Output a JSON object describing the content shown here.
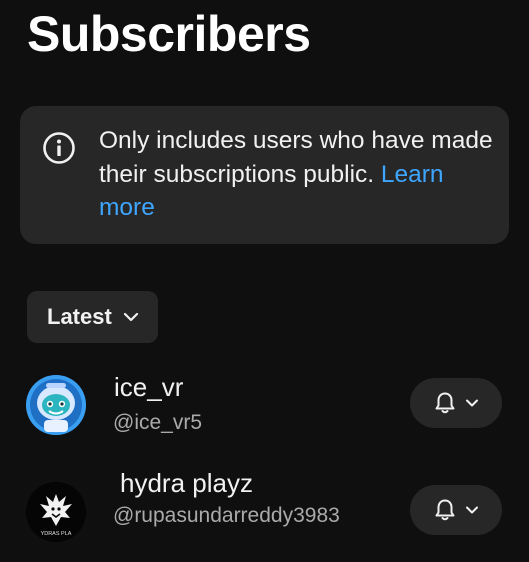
{
  "header": {
    "title": "Subscribers"
  },
  "notice": {
    "text": "Only includes users who have made their subscriptions public.",
    "link_label": "Learn more"
  },
  "sort": {
    "selected": "Latest"
  },
  "subscribers": [
    {
      "name": "ice_vr",
      "handle": "@ice_vr5",
      "avatar_icon": "astronaut-avatar-icon"
    },
    {
      "name": "hydra playz",
      "handle": "@rupasundarreddy3983",
      "avatar_icon": "hydra-logo-avatar-icon",
      "avatar_text": "YDRAS PLA"
    }
  ],
  "colors": {
    "background": "#0f0f0f",
    "card": "#272727",
    "link": "#3ea6ff",
    "secondary_text": "#aaaaaa"
  }
}
